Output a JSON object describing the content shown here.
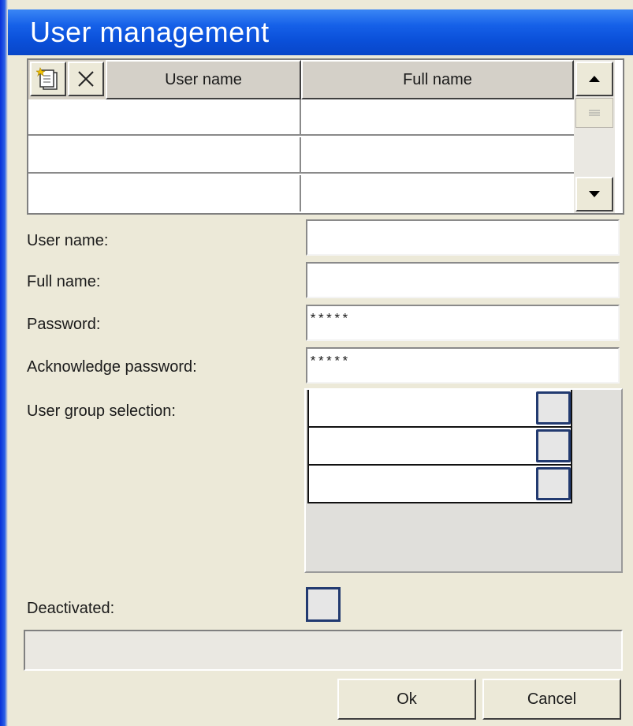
{
  "window": {
    "title": "User management"
  },
  "grid": {
    "columns": [
      "User name",
      "Full name"
    ],
    "rows": [
      {
        "user_name": "",
        "full_name": ""
      },
      {
        "user_name": "",
        "full_name": ""
      },
      {
        "user_name": "",
        "full_name": ""
      }
    ]
  },
  "toolbar": {
    "new_icon": "new-document-icon",
    "delete_icon": "delete-x-icon"
  },
  "form": {
    "user_name_label": "User name:",
    "user_name_value": "",
    "full_name_label": "Full name:",
    "full_name_value": "",
    "password_label": "Password:",
    "password_value": "*****",
    "ack_password_label": "Acknowledge password:",
    "ack_password_value": "*****",
    "group_label": "User group selection:",
    "deactivated_label": "Deactivated:",
    "deactivated_checked": false
  },
  "groups": [
    {
      "name": "",
      "checked": false
    },
    {
      "name": "",
      "checked": false
    },
    {
      "name": "",
      "checked": false
    }
  ],
  "status_text": "",
  "buttons": {
    "ok": "Ok",
    "cancel": "Cancel"
  },
  "colors": {
    "title_bar": "#0a4fd8",
    "window_bg": "#ece9d8",
    "check_border": "#223a70"
  }
}
